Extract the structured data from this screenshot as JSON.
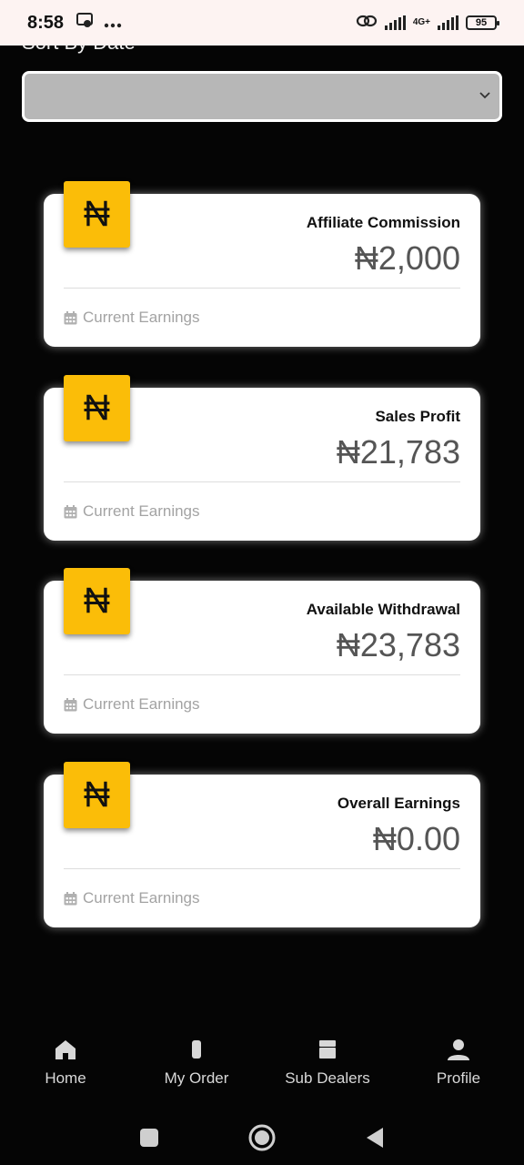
{
  "status_bar": {
    "time": "8:58",
    "network": "4G+",
    "battery": "95"
  },
  "filter": {
    "label": "Sort By Date",
    "selected_value": ""
  },
  "cards": [
    {
      "title": "Affiliate Commission",
      "value": "₦2,000",
      "footer": "Current Earnings",
      "icon": "naira-icon"
    },
    {
      "title": "Sales Profit",
      "value": "₦21,783",
      "footer": "Current Earnings",
      "icon": "naira-icon"
    },
    {
      "title": "Available Withdrawal",
      "value": "₦23,783",
      "footer": "Current Earnings",
      "icon": "naira-icon"
    },
    {
      "title": "Overall Earnings",
      "value": "₦0.00",
      "footer": "Current Earnings",
      "icon": "naira-icon"
    }
  ],
  "bottom_nav": [
    {
      "label": "Home",
      "icon": "home-icon"
    },
    {
      "label": "My Order",
      "icon": "phone-icon"
    },
    {
      "label": "Sub Dealers",
      "icon": "store-icon"
    },
    {
      "label": "Profile",
      "icon": "person-icon"
    }
  ],
  "colors": {
    "accent": "#fbbd08",
    "background": "#050505",
    "dropdown": "#b7b7b7"
  }
}
